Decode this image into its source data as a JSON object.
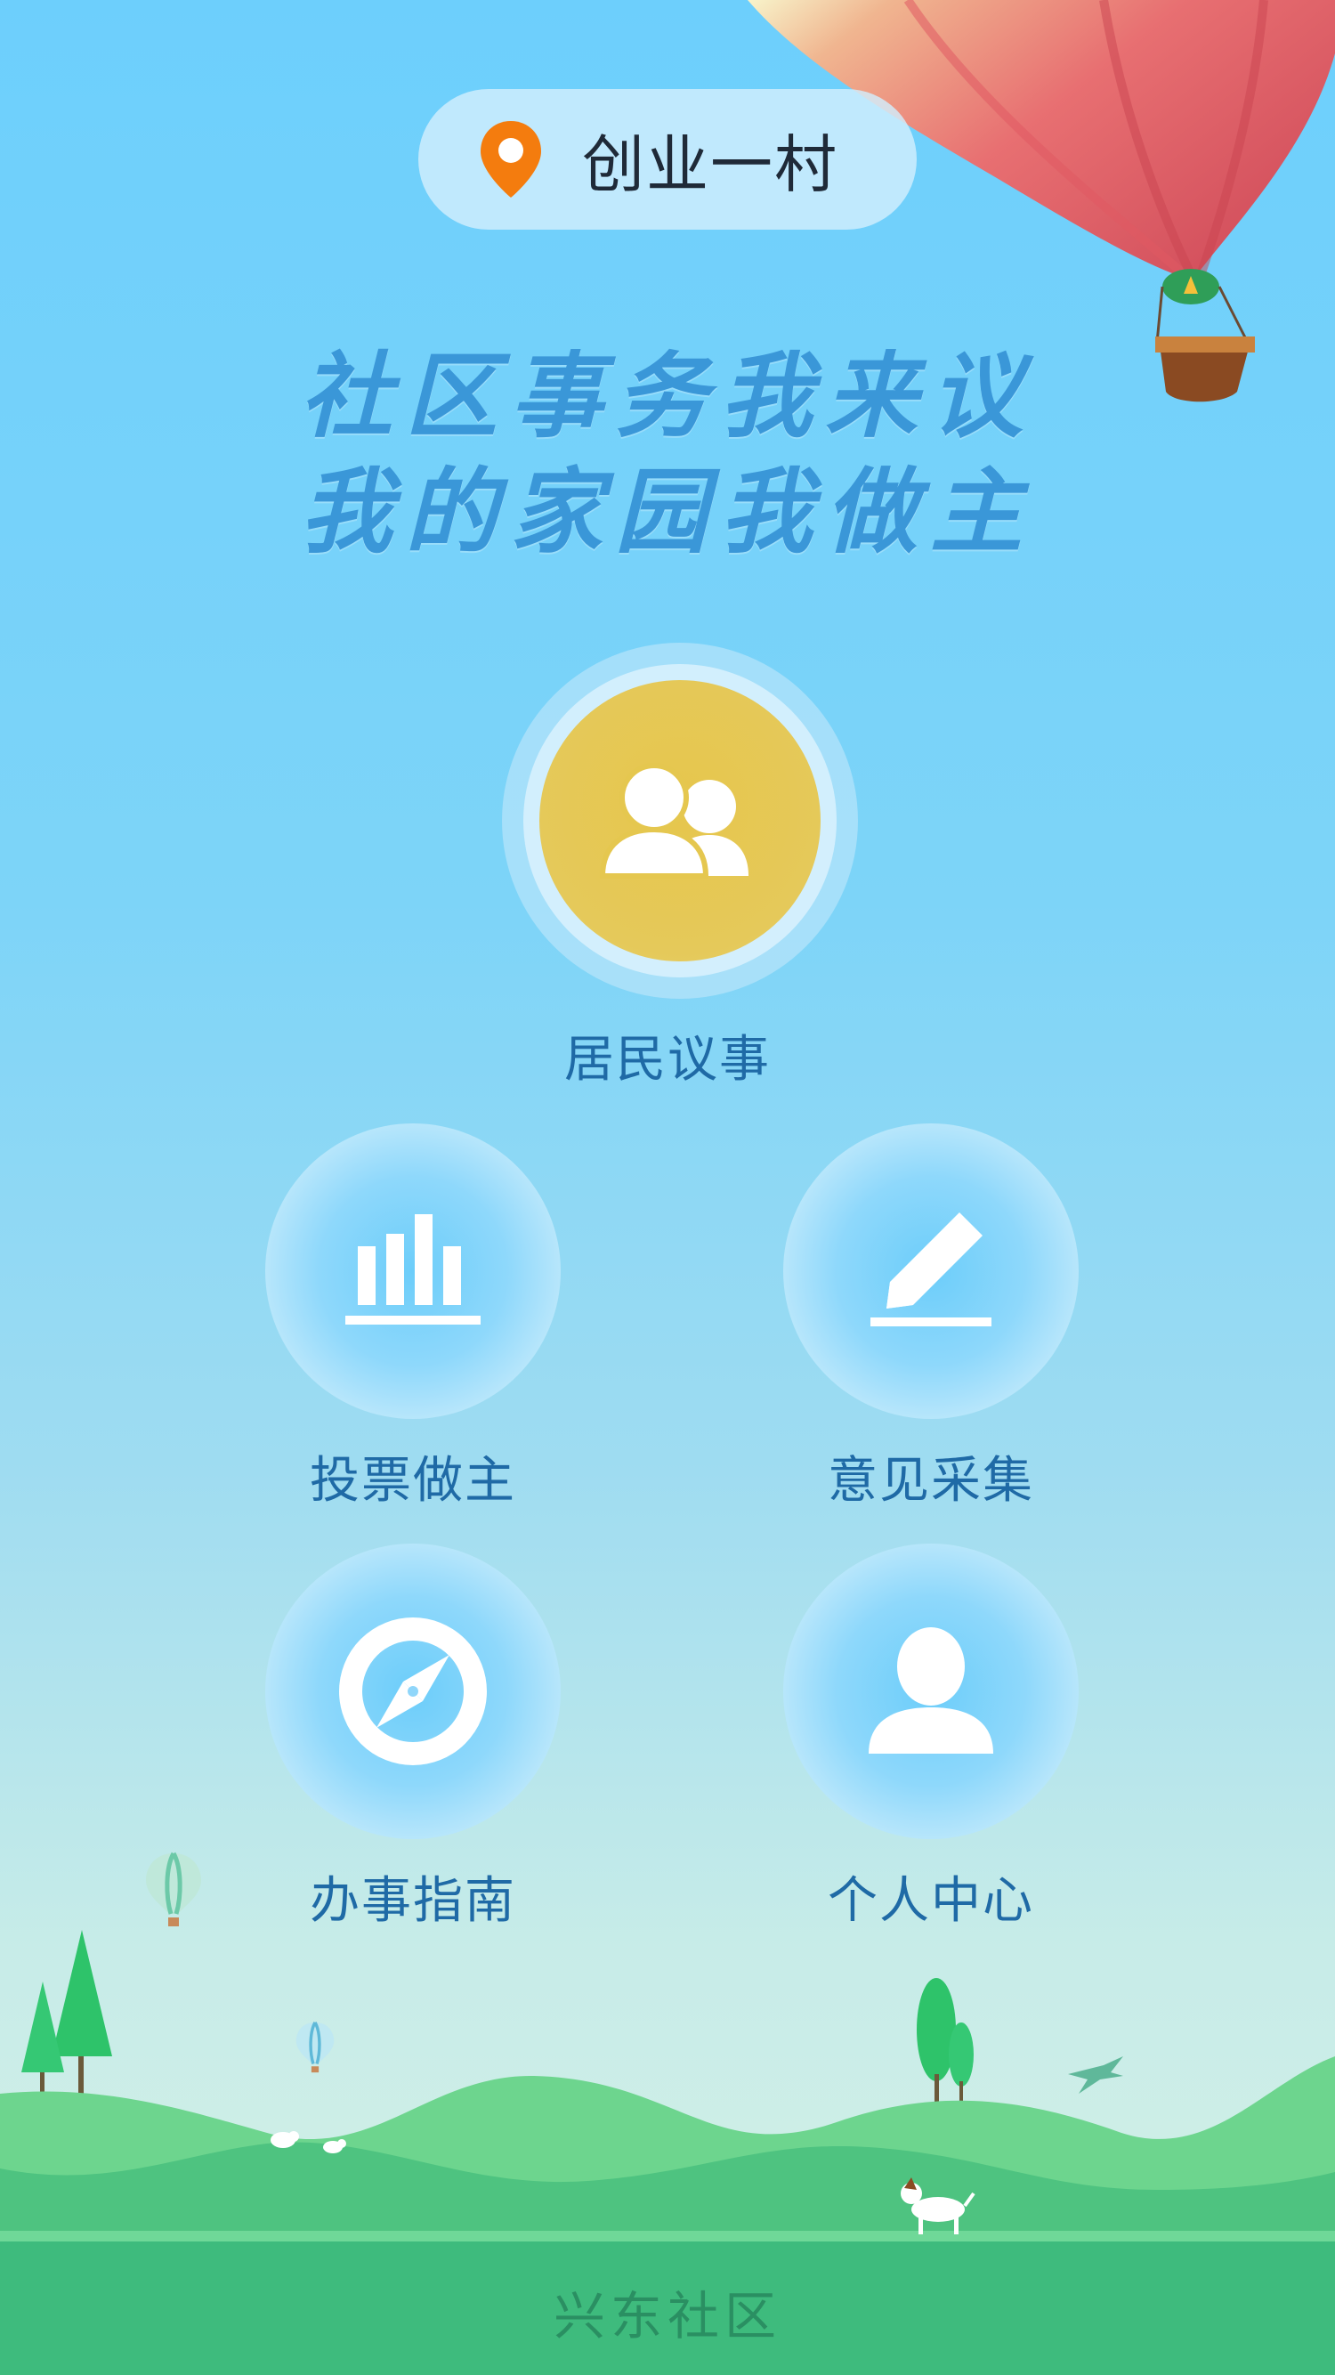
{
  "header": {
    "location": "创业一村",
    "location_icon": "location-pin-icon"
  },
  "slogan": {
    "line1": "社区事务我来议",
    "line2": "我的家园我做主"
  },
  "menu": {
    "main": {
      "label": "居民议事",
      "icon": "people-group-icon"
    },
    "items": [
      {
        "label": "投票做主",
        "icon": "bar-chart-icon"
      },
      {
        "label": "意见采集",
        "icon": "pen-edit-icon"
      },
      {
        "label": "办事指南",
        "icon": "compass-icon"
      },
      {
        "label": "个人中心",
        "icon": "person-icon"
      }
    ]
  },
  "footer": {
    "community": "兴东社区"
  },
  "colors": {
    "sky_top": "#6dcffc",
    "main_button": "#e6c64c",
    "label_text": "#1f6aa6",
    "hill_dark": "#3ebb7d",
    "hill_light": "#6dd58e",
    "pin": "#f47c0e"
  }
}
